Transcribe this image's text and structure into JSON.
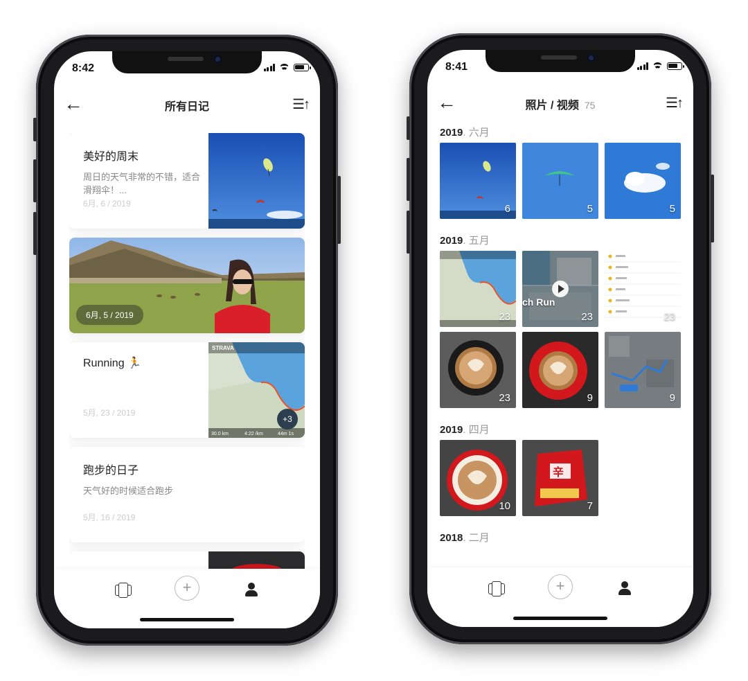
{
  "left_phone": {
    "status": {
      "time": "8:42"
    },
    "nav": {
      "title": "所有日记"
    },
    "entries": [
      {
        "title": "美好的周末",
        "desc": "周日的天气非常的不错，适合滑翔伞！...",
        "date": "6月, 6 / 2019"
      },
      {
        "date": "6月, 5 / 2019"
      },
      {
        "title": "Running 🏃",
        "date": "5月, 23 / 2019",
        "badge": "+3"
      },
      {
        "title": "跑步的日子",
        "desc": "天气好的时候适合跑步",
        "date": "5月, 16 / 2019"
      }
    ]
  },
  "right_phone": {
    "status": {
      "time": "8:41"
    },
    "nav": {
      "title": "照片 / 视频",
      "count": "75"
    },
    "sections": [
      {
        "year": "2019",
        "month": ". 六月",
        "tiles": [
          {
            "count": "6",
            "kind": "paragliders-sky"
          },
          {
            "count": "5",
            "kind": "paraglider-green"
          },
          {
            "count": "5",
            "kind": "clouds-sky"
          }
        ]
      },
      {
        "year": "2019",
        "month": ". 五月",
        "tiles": [
          {
            "count": "23",
            "kind": "strava-map"
          },
          {
            "count": "23",
            "kind": "aerial-video",
            "label": "ch Run"
          },
          {
            "count": "23",
            "kind": "run-list"
          },
          {
            "count": "23",
            "kind": "latte-black"
          },
          {
            "count": "9",
            "kind": "latte-red"
          },
          {
            "count": "9",
            "kind": "route-map"
          }
        ]
      },
      {
        "year": "2019",
        "month": ". 四月",
        "tiles": [
          {
            "count": "10",
            "kind": "latte-red"
          },
          {
            "count": "7",
            "kind": "noodle-pack"
          }
        ]
      },
      {
        "year": "2018",
        "month": ". 二月",
        "tiles": []
      }
    ]
  },
  "colors": {
    "accent_dark": "#1b1b1d",
    "sky": "#1f5fbf",
    "text_muted": "#999999"
  }
}
